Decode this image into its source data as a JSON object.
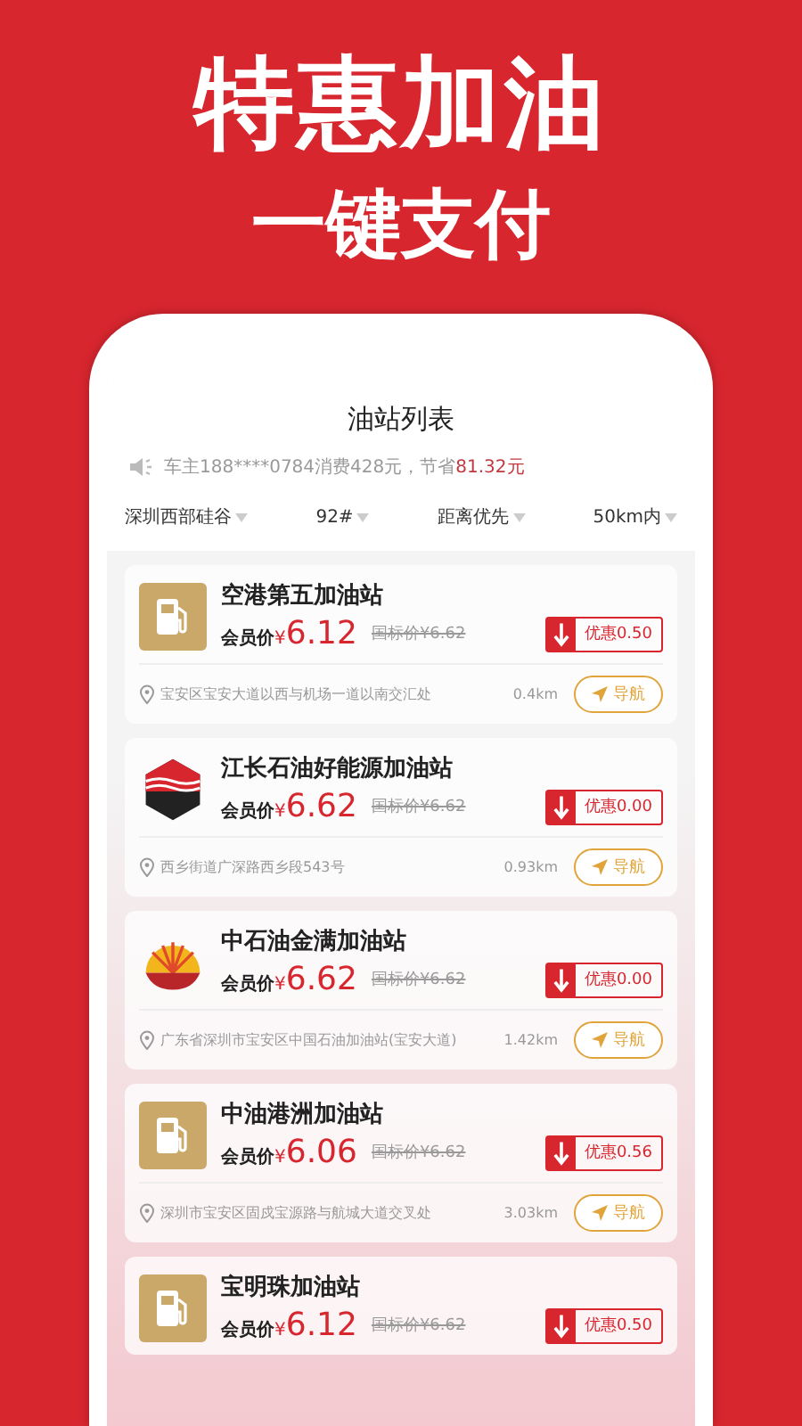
{
  "headline": "特惠加油",
  "subheadline": "一键支付",
  "screen": {
    "title": "油站列表",
    "notice": {
      "text": "车主188****0784消费428元，节省",
      "highlight": "81.32元"
    },
    "filters": [
      {
        "label": "深圳西部硅谷"
      },
      {
        "label": "92#"
      },
      {
        "label": "距离优先"
      },
      {
        "label": "50km内"
      }
    ],
    "stations": [
      {
        "kind": "pump",
        "name": "空港第五加油站",
        "member_label": "会员价",
        "currency": "¥",
        "price": "6.12",
        "list_price": "国标价¥6.62",
        "discount": "优惠0.50",
        "address": "宝安区宝安大道以西与机场一道以南交汇处",
        "distance": "0.4km",
        "nav": "导航"
      },
      {
        "kind": "hexagon",
        "name": "江长石油好能源加油站",
        "member_label": "会员价",
        "currency": "¥",
        "price": "6.62",
        "list_price": "国标价¥6.62",
        "discount": "优惠0.00",
        "address": "西乡街道广深路西乡段543号",
        "distance": "0.93km",
        "nav": "导航"
      },
      {
        "kind": "shell",
        "name": "中石油金满加油站",
        "member_label": "会员价",
        "currency": "¥",
        "price": "6.62",
        "list_price": "国标价¥6.62",
        "discount": "优惠0.00",
        "address": "广东省深圳市宝安区中国石油加油站(宝安大道)",
        "distance": "1.42km",
        "nav": "导航"
      },
      {
        "kind": "pump",
        "name": "中油港洲加油站",
        "member_label": "会员价",
        "currency": "¥",
        "price": "6.06",
        "list_price": "国标价¥6.62",
        "discount": "优惠0.56",
        "address": "深圳市宝安区固戍宝源路与航城大道交叉处",
        "distance": "3.03km",
        "nav": "导航"
      },
      {
        "kind": "pump",
        "name": "宝明珠加油站",
        "member_label": "会员价",
        "currency": "¥",
        "price": "6.12",
        "list_price": "国标价¥6.62",
        "discount": "优惠0.50"
      }
    ]
  }
}
